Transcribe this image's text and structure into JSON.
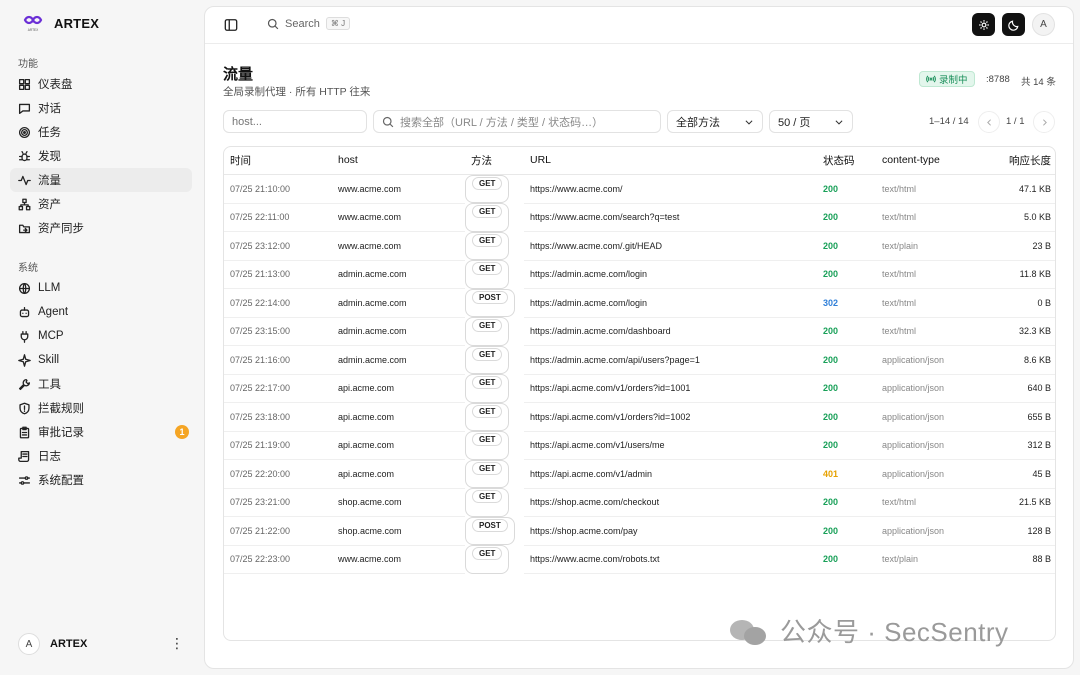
{
  "brand": {
    "name": "ARTEX",
    "logo_caption": "ARTEX"
  },
  "sidebar": {
    "section_features": "功能",
    "features": [
      {
        "label": "仪表盘",
        "icon": "dashboard-icon"
      },
      {
        "label": "对话",
        "icon": "chat-icon"
      },
      {
        "label": "任务",
        "icon": "target-icon"
      },
      {
        "label": "发现",
        "icon": "bug-icon"
      },
      {
        "label": "流量",
        "icon": "activity-icon",
        "active": true
      },
      {
        "label": "资产",
        "icon": "network-icon"
      },
      {
        "label": "资产同步",
        "icon": "folder-sync-icon"
      }
    ],
    "section_system": "系统",
    "system": [
      {
        "label": "LLM",
        "icon": "globe-icon"
      },
      {
        "label": "Agent",
        "icon": "bot-icon"
      },
      {
        "label": "MCP",
        "icon": "plug-icon"
      },
      {
        "label": "Skill",
        "icon": "sparkle-icon"
      },
      {
        "label": "工具",
        "icon": "wrench-icon"
      },
      {
        "label": "拦截规则",
        "icon": "shield-icon"
      },
      {
        "label": "审批记录",
        "icon": "clipboard-icon",
        "badge": "1"
      },
      {
        "label": "日志",
        "icon": "scroll-icon"
      },
      {
        "label": "系统配置",
        "icon": "sliders-icon"
      }
    ],
    "user": {
      "initial": "A",
      "name": "ARTEX",
      "more": "⋮"
    }
  },
  "topbar": {
    "search_label": "Search",
    "shortcut": "⌘ J",
    "avatar": "A"
  },
  "page": {
    "title": "流量",
    "subtitle": "全局录制代理 · 所有 HTTP 往来",
    "recording": "录制中",
    "port": ":8788",
    "total": "共 14 条"
  },
  "filters": {
    "host_placeholder": "host...",
    "search_placeholder": "搜索全部（URL / 方法 / 类型 / 状态码…）",
    "method_select": "全部方法",
    "page_size": "50 / 页",
    "range": "1–14 / 14",
    "page": "1 / 1"
  },
  "table": {
    "headers": [
      "时间",
      "host",
      "方法",
      "URL",
      "状态码",
      "content-type",
      "响应长度"
    ],
    "rows": [
      [
        "07/25 21:10:00",
        "www.acme.com",
        "GET",
        "https://www.acme.com/",
        "200",
        "text/html",
        "47.1 KB"
      ],
      [
        "07/25 22:11:00",
        "www.acme.com",
        "GET",
        "https://www.acme.com/search?q=test",
        "200",
        "text/html",
        "5.0 KB"
      ],
      [
        "07/25 23:12:00",
        "www.acme.com",
        "GET",
        "https://www.acme.com/.git/HEAD",
        "200",
        "text/plain",
        "23 B"
      ],
      [
        "07/25 21:13:00",
        "admin.acme.com",
        "GET",
        "https://admin.acme.com/login",
        "200",
        "text/html",
        "11.8 KB"
      ],
      [
        "07/25 22:14:00",
        "admin.acme.com",
        "POST",
        "https://admin.acme.com/login",
        "302",
        "text/html",
        "0 B"
      ],
      [
        "07/25 23:15:00",
        "admin.acme.com",
        "GET",
        "https://admin.acme.com/dashboard",
        "200",
        "text/html",
        "32.3 KB"
      ],
      [
        "07/25 21:16:00",
        "admin.acme.com",
        "GET",
        "https://admin.acme.com/api/users?page=1",
        "200",
        "application/json",
        "8.6 KB"
      ],
      [
        "07/25 22:17:00",
        "api.acme.com",
        "GET",
        "https://api.acme.com/v1/orders?id=1001",
        "200",
        "application/json",
        "640 B"
      ],
      [
        "07/25 23:18:00",
        "api.acme.com",
        "GET",
        "https://api.acme.com/v1/orders?id=1002",
        "200",
        "application/json",
        "655 B"
      ],
      [
        "07/25 21:19:00",
        "api.acme.com",
        "GET",
        "https://api.acme.com/v1/users/me",
        "200",
        "application/json",
        "312 B"
      ],
      [
        "07/25 22:20:00",
        "api.acme.com",
        "GET",
        "https://api.acme.com/v1/admin",
        "401",
        "application/json",
        "45 B"
      ],
      [
        "07/25 23:21:00",
        "shop.acme.com",
        "GET",
        "https://shop.acme.com/checkout",
        "200",
        "text/html",
        "21.5 KB"
      ],
      [
        "07/25 21:22:00",
        "shop.acme.com",
        "POST",
        "https://shop.acme.com/pay",
        "200",
        "application/json",
        "128 B"
      ],
      [
        "07/25 22:23:00",
        "www.acme.com",
        "GET",
        "https://www.acme.com/robots.txt",
        "200",
        "text/plain",
        "88 B"
      ]
    ]
  },
  "watermark": {
    "text": "公众号 · SecSentry"
  },
  "colors": {
    "status_2xx": "#18a058",
    "status_3xx": "#2f7fd8",
    "status_4xx": "#e6a100",
    "recording": "#1a8f5a",
    "badge": "#f5a524"
  }
}
